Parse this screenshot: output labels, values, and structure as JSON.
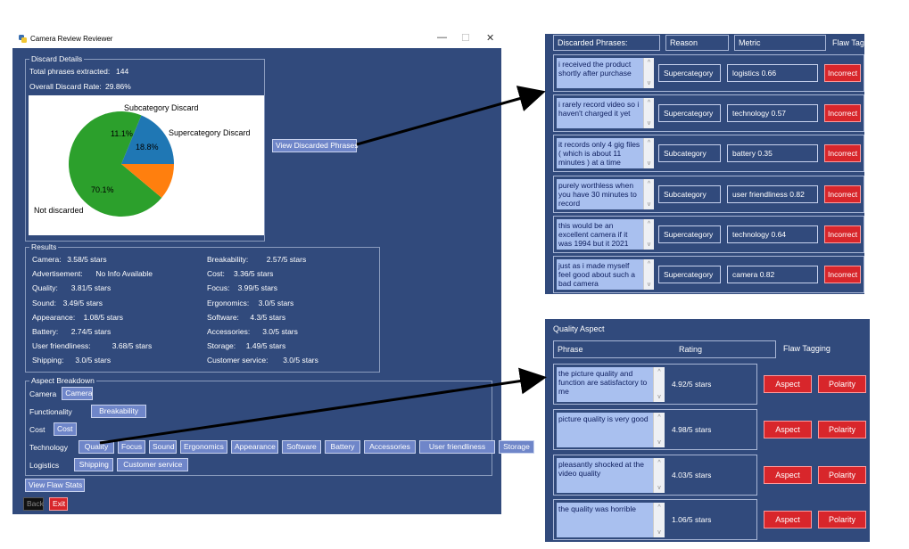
{
  "window": {
    "title": "Camera Review Reviewer",
    "controls": [
      "—",
      "☐",
      "✕"
    ]
  },
  "discard_details": {
    "group_title": "Discard Details",
    "total_label": "Total phrases extracted:",
    "total_value": "144",
    "rate_label": "Overall Discard Rate:",
    "rate_value": "29.86%",
    "view_button": "View Discarded Phrases"
  },
  "chart_data": {
    "type": "pie",
    "labels": [
      "Supercategory Discard",
      "Not discarded",
      "Subcategory Discard"
    ],
    "values": [
      18.8,
      70.1,
      11.1
    ],
    "value_labels": [
      "18.8%",
      "70.1%",
      "11.1%"
    ],
    "colors": [
      "#1f77b4",
      "#2ca02c",
      "#ff7f0e"
    ]
  },
  "results": {
    "group_title": "Results",
    "left": [
      {
        "label": "Camera:",
        "value": "3.58/5 stars"
      },
      {
        "label": "Advertisement:",
        "value": "No Info Available"
      },
      {
        "label": "Quality:",
        "value": "3.81/5 stars"
      },
      {
        "label": "Sound:",
        "value": "3.49/5 stars"
      },
      {
        "label": "Appearance:",
        "value": "1.08/5 stars"
      },
      {
        "label": "Battery:",
        "value": "2.74/5 stars"
      },
      {
        "label": "User friendliness:",
        "value": "3.68/5 stars"
      },
      {
        "label": "Shipping:",
        "value": "3.0/5 stars"
      }
    ],
    "right": [
      {
        "label": "Breakability:",
        "value": "2.57/5 stars"
      },
      {
        "label": "Cost:",
        "value": "3.36/5 stars"
      },
      {
        "label": "Focus:",
        "value": "3.99/5 stars"
      },
      {
        "label": "Ergonomics:",
        "value": "3.0/5 stars"
      },
      {
        "label": "Software:",
        "value": "4.3/5 stars"
      },
      {
        "label": "Accessories:",
        "value": "3.0/5 stars"
      },
      {
        "label": "Storage:",
        "value": "1.49/5 stars"
      },
      {
        "label": "Customer service:",
        "value": "3.0/5 stars"
      }
    ]
  },
  "aspect_breakdown": {
    "group_title": "Aspect Breakdown",
    "rows": [
      {
        "category": "Camera",
        "aspects": [
          "Camera"
        ]
      },
      {
        "category": "Functionality",
        "aspects": [
          "Breakability"
        ]
      },
      {
        "category": "Cost",
        "aspects": [
          "Cost"
        ]
      },
      {
        "category": "Technology",
        "aspects": [
          "Quality",
          "Focus",
          "Sound",
          "Ergonomics",
          "Appearance",
          "Software",
          "Battery",
          "Accessories",
          "User friendliness",
          "Storage"
        ]
      },
      {
        "category": "Logistics",
        "aspects": [
          "Shipping",
          "Customer service"
        ]
      }
    ]
  },
  "bottom": {
    "flaw_stats": "View Flaw Stats",
    "back": "Back",
    "exit": "Exit"
  },
  "discarded": {
    "headers": {
      "phrases": "Discarded Phrases:",
      "reason": "Reason",
      "metric": "Metric",
      "flaw": "Flaw Tagging"
    },
    "rows": [
      {
        "phrase": "i received the product shortly after purchase",
        "reason": "Supercategory",
        "metric": "logistics 0.66",
        "tag": "Incorrect"
      },
      {
        "phrase": "i rarely record video   so i haven't charged it yet",
        "reason": "Supercategory",
        "metric": "technology 0.57",
        "tag": "Incorrect"
      },
      {
        "phrase": "it records only 4 gig files ( which is about 11 minutes ) at a time",
        "reason": "Subcategory",
        "metric": "battery 0.35",
        "tag": "Incorrect"
      },
      {
        "phrase": "purely worthless when you have 30 minutes to record",
        "reason": "Subcategory",
        "metric": "user friendliness 0.82",
        "tag": "Incorrect"
      },
      {
        "phrase": "this would be an excellent camera if it was 1994 but it 2021",
        "reason": "Supercategory",
        "metric": "technology 0.64",
        "tag": "Incorrect"
      },
      {
        "phrase": "just as i made myself feel good about such a bad camera",
        "reason": "Supercategory",
        "metric": "camera 0.82",
        "tag": "Incorrect"
      }
    ]
  },
  "quality": {
    "title": "Quality Aspect",
    "headers": {
      "phrase": "Phrase",
      "rating": "Rating",
      "flaw": "Flaw Tagging"
    },
    "rows": [
      {
        "phrase": "the picture quality and function are satisfactory to me",
        "rating": "4.92/5 stars",
        "aspect": "Aspect",
        "polarity": "Polarity"
      },
      {
        "phrase": "picture quality is very good",
        "rating": "4.98/5 stars",
        "aspect": "Aspect",
        "polarity": "Polarity"
      },
      {
        "phrase": "pleasantly shocked at the video quality",
        "rating": "4.03/5 stars",
        "aspect": "Aspect",
        "polarity": "Polarity"
      },
      {
        "phrase": "the quality was horrible",
        "rating": "1.06/5 stars",
        "aspect": "Aspect",
        "polarity": "Polarity"
      }
    ]
  }
}
